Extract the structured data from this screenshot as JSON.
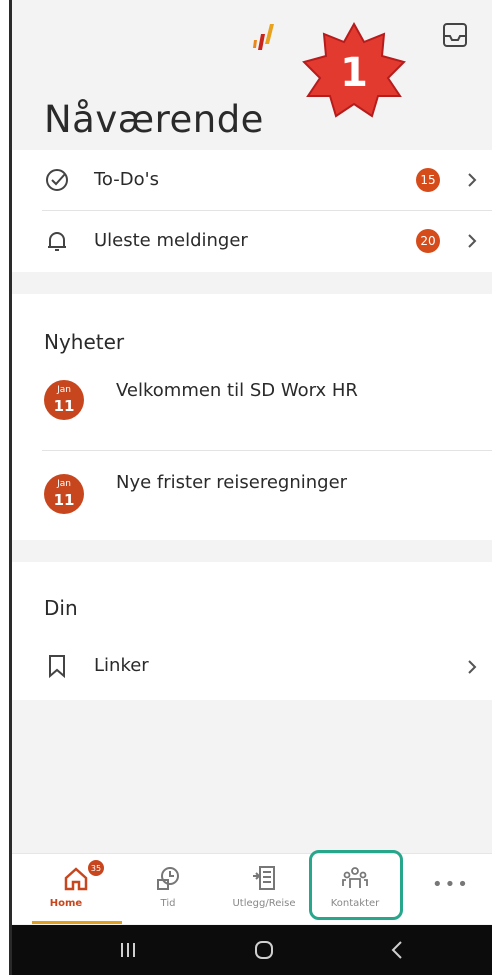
{
  "header": {
    "title": "Nåværende",
    "step_number": "1",
    "brand_colors": {
      "orange": "#e8871e",
      "red": "#c8261d",
      "accent": "#d54b1a"
    }
  },
  "current": {
    "items": [
      {
        "label": "To-Do's",
        "count": "15",
        "icon": "check-circle-icon"
      },
      {
        "label": "Uleste meldinger",
        "count": "20",
        "icon": "bell-icon"
      }
    ]
  },
  "news": {
    "title": "Nyheter",
    "items": [
      {
        "month": "Jan",
        "day": "11",
        "title": "Velkommen til SD Worx HR"
      },
      {
        "month": "Jan",
        "day": "11",
        "title": "Nye frister reiseregninger"
      }
    ]
  },
  "din": {
    "title": "Din",
    "items": [
      {
        "label": "Linker",
        "icon": "bookmark-icon"
      }
    ]
  },
  "bottom_nav": {
    "items": [
      {
        "label": "Home",
        "badge": "35",
        "active": true
      },
      {
        "label": "Tid"
      },
      {
        "label": "Utlegg/Reise"
      },
      {
        "label": "Kontakter",
        "highlighted": true
      },
      {
        "label": "more"
      }
    ]
  }
}
